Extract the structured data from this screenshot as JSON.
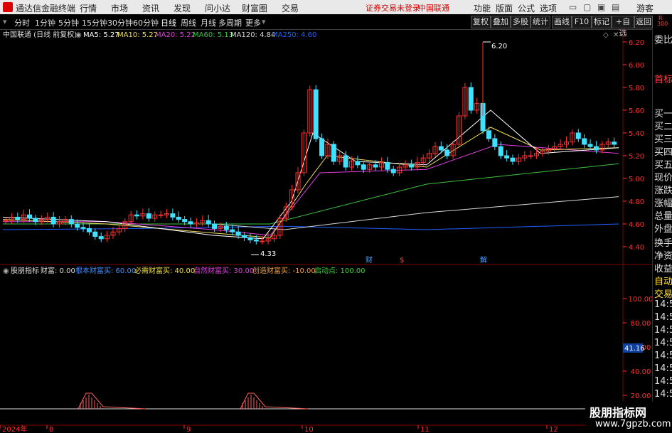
{
  "app": {
    "title": "通达信金融终端",
    "menu": [
      "行情",
      "市场",
      "资讯",
      "发现",
      "问小达",
      "财富圈",
      "交易"
    ],
    "notice": "证券交易未登录",
    "stock_link": "中国联通",
    "right_menu": [
      "功能",
      "版面",
      "公式",
      "选项"
    ],
    "user": "游客"
  },
  "periods": {
    "items": [
      "分时",
      "1分钟",
      "5分钟",
      "15分钟",
      "30分钟",
      "60分钟",
      "日线",
      "周线",
      "月线",
      "多周期",
      "更多"
    ],
    "active": "日线",
    "buttons": [
      "复权",
      "叠加",
      "多股",
      "统计",
      "画线",
      "F10",
      "标记",
      "+自选",
      "返回"
    ]
  },
  "main_chart": {
    "stock_label": "中国联通 (日线 前复权)",
    "ma": [
      {
        "label": "MA5: 5.27",
        "color": "#ffffff"
      },
      {
        "label": "MA10: 5.27",
        "color": "#f0e060"
      },
      {
        "label": "MA20: 5.22",
        "color": "#e040e0"
      },
      {
        "label": "MA60: 5.13",
        "color": "#40c040"
      },
      {
        "label": "MA120: 4.84",
        "color": "#d8d8d8"
      },
      {
        "label": "MA250: 4.60",
        "color": "#2060ff"
      }
    ],
    "price_axis": [
      "6.20",
      "6.00",
      "5.80",
      "5.60",
      "5.40",
      "5.20",
      "5.00",
      "4.80",
      "4.60",
      "4.40"
    ],
    "high_label": "6.20",
    "low_label": "4.33",
    "markers": [
      "财",
      "$",
      "解"
    ],
    "date_axis": [
      "2024年",
      "8",
      "9",
      "10",
      "11",
      "12"
    ]
  },
  "indicator": {
    "title": "股朋指标",
    "values": [
      {
        "label": "财富: 0.00",
        "color": "#dddddd"
      },
      {
        "label": "根本财富买: 60.00",
        "color": "#4090ff"
      },
      {
        "label": "必需财富买: 40.00",
        "color": "#f0e040"
      },
      {
        "label": "自然财富买: 30.00",
        "color": "#e040e0"
      },
      {
        "label": "创造财富买: -10.00",
        "color": "#f0a040"
      },
      {
        "label": "启动点: 100.00",
        "color": "#40d040"
      }
    ],
    "axis": [
      "100.00",
      "80.00",
      "60.00",
      "40.00",
      "20.00"
    ],
    "current_value": "41.16"
  },
  "right_panel": {
    "top": [
      "R",
      "300"
    ],
    "items": [
      "委比",
      "首标",
      "买一",
      "买二",
      "买三",
      "买四",
      "买五",
      "现价",
      "涨跌",
      "涨幅",
      "总量",
      "外盘",
      "换手",
      "净资",
      "收益",
      "自动",
      "交易",
      "14:56",
      "14:56",
      "14:56",
      "14:56",
      "14:56",
      "14:56",
      "14:56",
      "14:56",
      "14:56"
    ]
  },
  "watermark": {
    "line1": "股朋指标网",
    "line2": "www.7gpzb.com"
  },
  "colors": {
    "up": "#ff3030",
    "down": "#40e0ff",
    "axis": "#ff3030",
    "grid": "#3a0000"
  }
}
